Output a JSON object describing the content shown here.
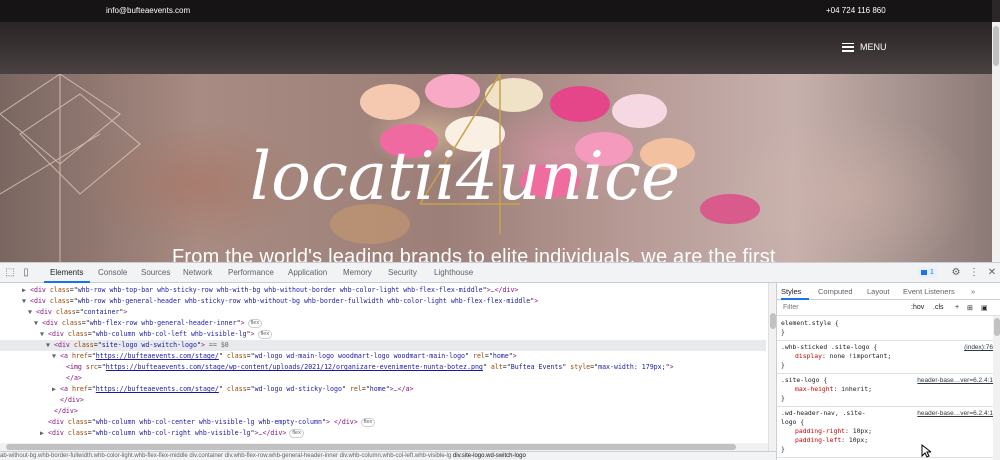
{
  "site": {
    "email": "info@bufteaevents.com",
    "phone": "+04 724 116 860",
    "menu_label": "MENU",
    "hero_logo": "locatii4unice",
    "tagline": "From the world's leading brands to elite individuals, we are the first"
  },
  "devtools": {
    "tabs": [
      "Elements",
      "Console",
      "Sources",
      "Network",
      "Performance",
      "Application",
      "Memory",
      "Security",
      "Lighthouse"
    ],
    "active_tab": "Elements",
    "issues_count": "1",
    "dom_lines": [
      {
        "indent": 5,
        "tri": "▶",
        "html": "<span class=\"tag\">&lt;div</span> <span class=\"attr\">class</span>=\"<span class=\"val\">whb-row whb-top-bar whb-sticky-row whb-with-bg whb-without-border whb-color-light whb-flex-flex-middle</span>\"<span class=\"tag\">&gt;</span><span class=\"dots\">…</span><span class=\"tag\">&lt;/div&gt;</span>"
      },
      {
        "indent": 5,
        "tri": "▼",
        "html": "<span class=\"tag\">&lt;div</span> <span class=\"attr\">class</span>=\"<span class=\"val\">whb-row whb-general-header whb-sticky-row whb-without-bg whb-border-fullwidth whb-color-light whb-flex-flex-middle</span>\"<span class=\"tag\">&gt;</span>"
      },
      {
        "indent": 6,
        "tri": "▼",
        "html": "<span class=\"tag\">&lt;div</span> <span class=\"attr\">class</span>=\"<span class=\"val\">container</span>\"<span class=\"tag\">&gt;</span>"
      },
      {
        "indent": 7,
        "tri": "▼",
        "html": "<span class=\"tag\">&lt;div</span> <span class=\"attr\">class</span>=\"<span class=\"val\">whb-flex-row whb-general-header-inner</span>\"<span class=\"tag\">&gt;</span><span class=\"flex\">flex</span>"
      },
      {
        "indent": 8,
        "tri": "▼",
        "html": "<span class=\"tag\">&lt;div</span> <span class=\"attr\">class</span>=\"<span class=\"val\">whb-column whb-col-left whb-visible-lg</span>\"<span class=\"tag\">&gt;</span><span class=\"flex\">flex</span>"
      },
      {
        "indent": 9,
        "tri": "▼",
        "sel": true,
        "html": "<span class=\"tag\">&lt;div</span> <span class=\"attr\">class</span>=\"<span class=\"val\">site-logo wd-switch-logo</span>\"<span class=\"tag\">&gt;</span> <span class=\"eq\">== $0</span>"
      },
      {
        "indent": 10,
        "tri": "▼",
        "html": "<span class=\"tag\">&lt;a</span> <span class=\"attr\">href</span>=\"<span class=\"lnk\">https://bufteaevents.com/stage/</span>\" <span class=\"attr\">class</span>=\"<span class=\"val\">wd-logo wd-main-logo woodmart-logo woodmart-main-logo</span>\" <span class=\"attr\">rel</span>=\"<span class=\"val\">home</span>\"<span class=\"tag\">&gt;</span>"
      },
      {
        "indent": 11,
        "tri": "",
        "html": "<span class=\"tag\">&lt;img</span> <span class=\"attr\">src</span>=\"<span class=\"lnk\">https://bufteaevents.com/stage/wp-content/uploads/2021/12/organizare-evenimente-nunta-botez.png</span>\" <span class=\"attr\">alt</span>=\"<span class=\"val\">Buftea Events</span>\" <span class=\"attr\">style</span>=\"<span class=\"val\">max-width: 179px;</span>\"<span class=\"tag\">&gt;</span>"
      },
      {
        "indent": 11,
        "tri": "",
        "html": "<span class=\"tag\">&lt;/a&gt;</span>"
      },
      {
        "indent": 10,
        "tri": "▶",
        "html": "<span class=\"tag\">&lt;a</span> <span class=\"attr\">href</span>=\"<span class=\"lnk\">https://bufteaevents.com/stage/</span>\" <span class=\"attr\">class</span>=\"<span class=\"val\">wd-logo wd-sticky-logo</span>\" <span class=\"attr\">rel</span>=\"<span class=\"val\">home</span>\"<span class=\"tag\">&gt;</span><span class=\"dots\">…</span><span class=\"tag\">&lt;/a&gt;</span>"
      },
      {
        "indent": 10,
        "tri": "",
        "html": "<span class=\"tag\">&lt;/div&gt;</span>"
      },
      {
        "indent": 9,
        "tri": "",
        "html": "<span class=\"tag\">&lt;/div&gt;</span>"
      },
      {
        "indent": 8,
        "tri": "",
        "html": "<span class=\"tag\">&lt;div</span> <span class=\"attr\">class</span>=\"<span class=\"val\">whb-column whb-col-center whb-visible-lg whb-empty-column</span>\"<span class=\"tag\">&gt;</span> <span class=\"tag\">&lt;/div&gt;</span><span class=\"flex\">flex</span>"
      },
      {
        "indent": 8,
        "tri": "▶",
        "html": "<span class=\"tag\">&lt;div</span> <span class=\"attr\">class</span>=\"<span class=\"val\">whb-column whb-col-right whb-visible-lg</span>\"<span class=\"tag\">&gt;</span><span class=\"dots\">…</span><span class=\"tag\">&lt;/div&gt;</span><span class=\"flex\">flex</span>"
      },
      {
        "indent": 8,
        "tri": "",
        "html": "<span class=\"dots\">…</span>"
      }
    ],
    "breadcrumbs": [
      "ab-without-bg.whb-border-fullwidth.whb-color-light.whb-flex-flex-middle",
      "div.container",
      "div.whb-flex-row.whb-general-header-inner",
      "div.whb-column.whb-col-left.whb-visible-lg",
      "div.site-logo.wd-switch-logo"
    ],
    "styles": {
      "tabs": [
        "Styles",
        "Computed",
        "Layout",
        "Event Listeners"
      ],
      "active_tab": "Styles",
      "filter_placeholder": "Filter",
      "filter_hov": ":hov",
      "filter_cls": ".cls",
      "rules": [
        {
          "lines": [
            {
              "t": "sel",
              "text": "element.style {"
            },
            {
              "t": "close",
              "text": "}"
            }
          ]
        },
        {
          "src": "(index):76",
          "lines": [
            {
              "t": "sel",
              "text": ".whb-sticked .site-logo {"
            },
            {
              "t": "prop",
              "name": "display",
              "value": "none !important;"
            },
            {
              "t": "close",
              "text": "}"
            }
          ]
        },
        {
          "src": "header-base…ver=6.2.4:1",
          "lines": [
            {
              "t": "sel",
              "text": ".site-logo {"
            },
            {
              "t": "prop",
              "name": "max-height",
              "value": "inherit;"
            },
            {
              "t": "close",
              "text": "}"
            }
          ]
        },
        {
          "src": "header-base…ver=6.2.4:1",
          "lines": [
            {
              "t": "sel",
              "text": ".wd-header-nav, .site-"
            },
            {
              "t": "sel",
              "text": "logo {"
            },
            {
              "t": "prop",
              "name": "padding-right",
              "value": "10px;"
            },
            {
              "t": "prop",
              "name": "padding-left",
              "value": "10px;"
            },
            {
              "t": "close",
              "text": "}"
            }
          ]
        }
      ]
    }
  }
}
